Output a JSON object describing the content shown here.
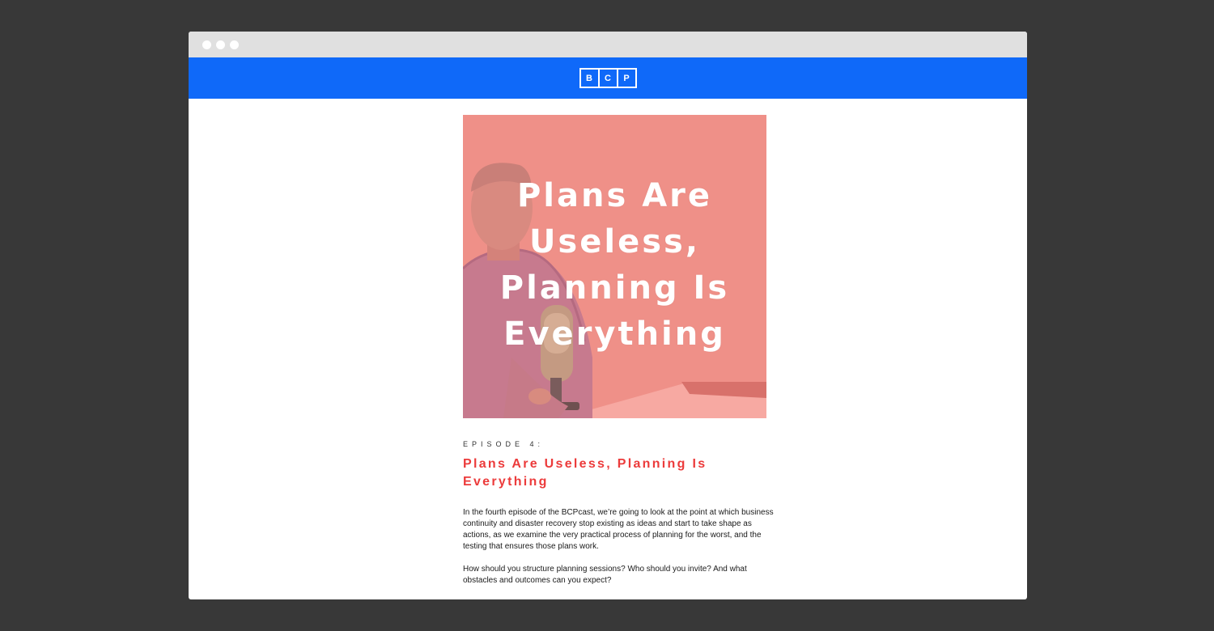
{
  "browser": {
    "window_dots": [
      "close",
      "minimize",
      "maximize"
    ]
  },
  "header": {
    "logo_letters": [
      "B",
      "C",
      "P"
    ],
    "background_color": "#0f69f9"
  },
  "hero": {
    "title": "Plans Are Useless, Planning Is Everything",
    "overlay_color": "#ef8a83"
  },
  "article": {
    "episode_label": "EPISODE 4:",
    "title": "Plans Are Useless, Planning Is Everything",
    "title_color": "#ec3b3b",
    "paragraph_1": "In the fourth episode of the BCPcast, we’re going to look at the point at which business continuity and disaster recovery stop existing as ideas and start to take shape as actions, as we examine the very practical process of planning for the worst, and the testing that ensures those plans work.",
    "paragraph_2": "How should you structure planning sessions? Who should you invite? And what obstacles and outcomes can you expect?"
  }
}
